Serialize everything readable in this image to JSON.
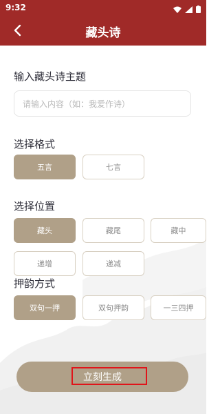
{
  "status_bar": {
    "time": "9:32"
  },
  "header": {
    "title": "藏头诗"
  },
  "input_section": {
    "title": "输入藏头诗主题",
    "placeholder": "请输入内容（如：我爱作诗）"
  },
  "format_section": {
    "title": "选择格式",
    "options": [
      "五言",
      "七言"
    ],
    "selected": "五言"
  },
  "position_section": {
    "title": "选择位置",
    "options": [
      "藏头",
      "藏尾",
      "藏中",
      "递增",
      "递减"
    ],
    "selected": "藏头"
  },
  "rhyme_section": {
    "title": "押韵方式",
    "options": [
      "双句一押",
      "双句押韵",
      "一三四押"
    ],
    "selected": "双句一押"
  },
  "generate_button": {
    "label": "立刻生成"
  },
  "colors": {
    "header_bg": "#a02a28",
    "chip_selected": "#b0a088",
    "highlight_border": "#e0141a"
  }
}
